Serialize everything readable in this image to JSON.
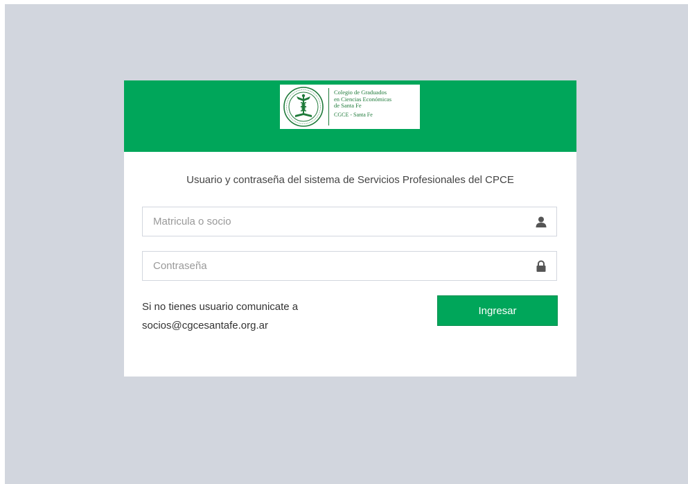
{
  "header": {
    "logo": {
      "line1": "Colegio de Graduados",
      "line2": "en Ciencias Económicas",
      "line3": "de Santa Fe",
      "line4": "CGCE - Santa Fe"
    },
    "background_color": "#00a65a"
  },
  "form": {
    "subtitle": "Usuario y contraseña del sistema de Servicios Profesionales del CPCE",
    "username": {
      "placeholder": "Matricula o socio",
      "value": "",
      "icon": "user-icon"
    },
    "password": {
      "placeholder": "Contraseña",
      "value": "",
      "icon": "lock-icon"
    },
    "help_line1": "Si no tienes usuario comunicate a",
    "help_line2": "socios@cgcesantafe.org.ar",
    "submit_label": "Ingresar"
  },
  "colors": {
    "page_background": "#d2d6de",
    "accent": "#00a65a",
    "logo_text": "#1f7a3a"
  }
}
